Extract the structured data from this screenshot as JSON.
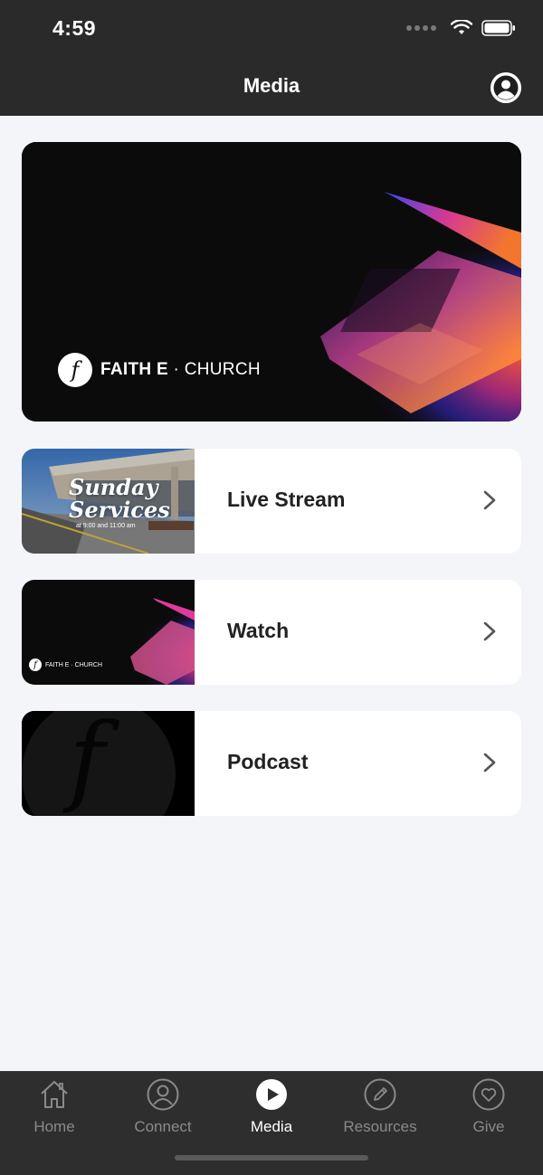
{
  "status_bar": {
    "time": "4:59"
  },
  "header": {
    "title": "Media"
  },
  "hero": {
    "logo_letter": "f",
    "brand_bold": "FAITH E",
    "brand_regular": "· CHURCH"
  },
  "media_items": [
    {
      "label": "Live Stream",
      "thumb_title_1": "Sunday",
      "thumb_title_2": "Services",
      "thumb_subtitle": "at 9:00 and 11:00 am"
    },
    {
      "label": "Watch",
      "thumb_brand": "FAITH E · CHURCH",
      "thumb_logo": "f"
    },
    {
      "label": "Podcast",
      "thumb_logo": "f"
    }
  ],
  "tabs": [
    {
      "label": "Home",
      "icon": "home-icon",
      "active": false
    },
    {
      "label": "Connect",
      "icon": "person-icon",
      "active": false
    },
    {
      "label": "Media",
      "icon": "play-icon",
      "active": true
    },
    {
      "label": "Resources",
      "icon": "pencil-icon",
      "active": false
    },
    {
      "label": "Give",
      "icon": "heart-icon",
      "active": false
    }
  ],
  "colors": {
    "nav_bg": "#2a2a2a",
    "page_bg": "#f4f5f9",
    "tab_active": "#ffffff",
    "tab_inactive": "#8a8a8a"
  }
}
